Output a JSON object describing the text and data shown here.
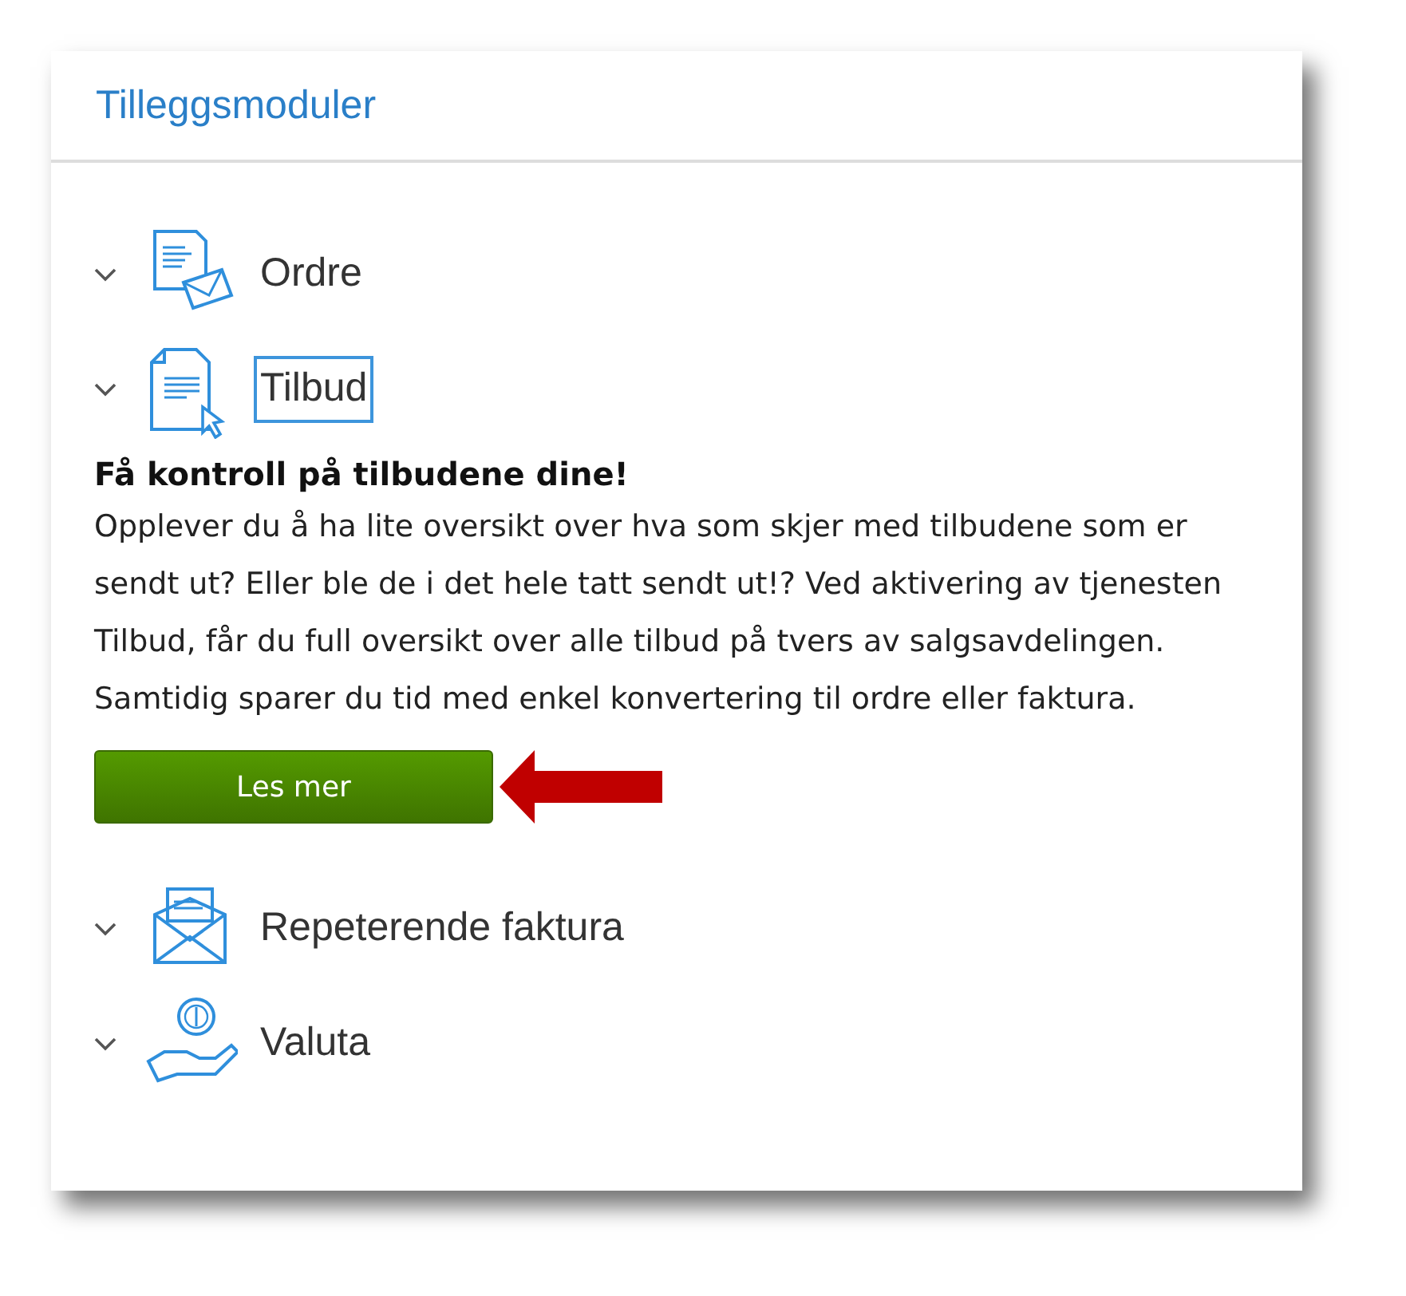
{
  "panel": {
    "title": "Tilleggsmoduler"
  },
  "modules": [
    {
      "label": "Ordre",
      "focused": false
    },
    {
      "label": "Tilbud",
      "focused": true,
      "heading": "Få kontroll på tilbudene dine!",
      "description": "Opplever du å ha lite oversikt over hva som skjer med tilbudene som er sendt ut? Eller ble de i det hele tatt sendt ut!? Ved aktivering av tjenesten Tilbud, får du full oversikt over alle tilbud på tvers av salgsavdelingen. Samtidig sparer du tid med enkel konvertering til ordre eller faktura.",
      "button": "Les mer"
    },
    {
      "label": "Repeterende faktura",
      "focused": false
    },
    {
      "label": "Valuta",
      "focused": false
    }
  ]
}
